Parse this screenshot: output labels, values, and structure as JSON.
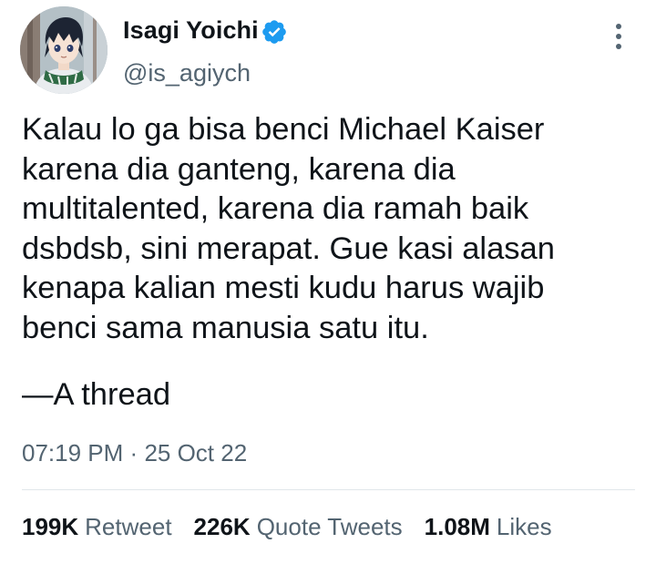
{
  "author": {
    "display_name": "Isagi Yoichi",
    "handle": "@is_agiych",
    "verified": true,
    "avatar": "anime-avatar"
  },
  "tweet": {
    "lines": [
      "Kalau lo ga bisa benci Michael Kaiser",
      "karena dia ganteng, karena dia",
      "multitalented, karena dia ramah baik",
      "dsbdsb, sini merapat. Gue kasi alasan",
      "kenapa kalian mesti kudu harus wajib",
      "benci sama manusia satu itu."
    ],
    "thread_marker": "—A thread"
  },
  "meta": {
    "time": "07:19 PM",
    "separator": "·",
    "date": "25 Oct 22"
  },
  "stats": [
    {
      "count": "199K",
      "label": "Retweet"
    },
    {
      "count": "226K",
      "label": "Quote Tweets"
    },
    {
      "count": "1.08M",
      "label": "Likes"
    }
  ],
  "colors": {
    "text": "#0f1419",
    "secondary": "#536471",
    "verified_badge": "#1d9bf0",
    "divider": "#e1e6ea"
  },
  "icons": {
    "verified": "verified-badge-icon",
    "more": "more-vertical-icon"
  }
}
